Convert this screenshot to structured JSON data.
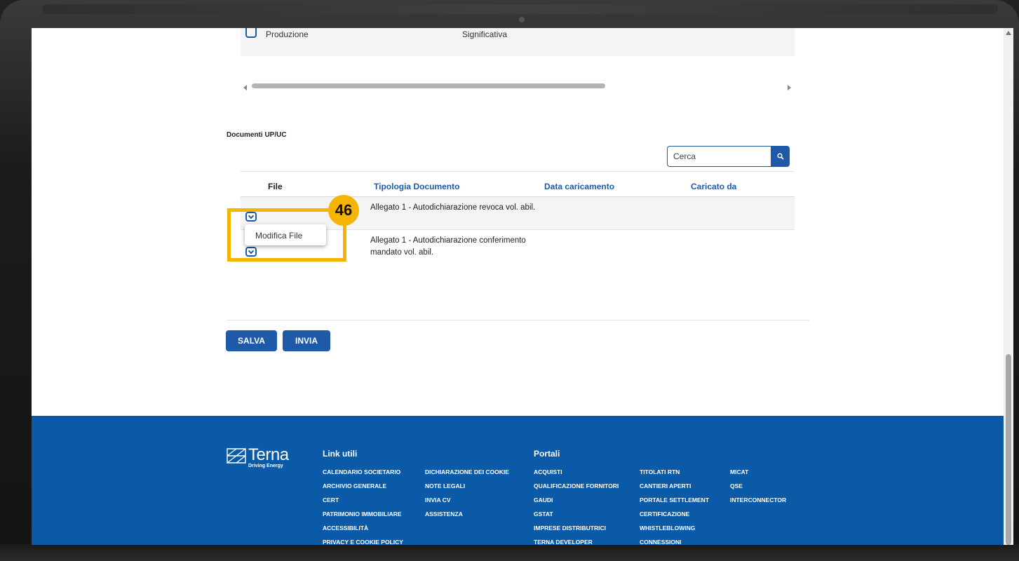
{
  "top_row": {
    "label": "Produzione",
    "value": "Significativa"
  },
  "section": {
    "title": "Documenti UP/UC"
  },
  "search": {
    "placeholder": "Cerca"
  },
  "table": {
    "headers": {
      "file": "File",
      "tipologia": "Tipologia Documento",
      "data": "Data caricamento",
      "caricato": "Caricato da"
    },
    "rows": [
      {
        "tipologia": "Allegato 1 - Autodichiarazione revoca vol. abil.",
        "data": "",
        "caricato": ""
      },
      {
        "tipologia": "Allegato 1 - Autodichiarazione conferimento mandato vol. abil.",
        "data": "",
        "caricato": ""
      }
    ]
  },
  "dropdown": {
    "item": "Modifica File"
  },
  "annotation": {
    "step": "46",
    "color": "#f5b400"
  },
  "actions": {
    "save": "SALVA",
    "send": "INVIA"
  },
  "colors": {
    "primary": "#1f5aa8",
    "footer": "#0a5aa8"
  },
  "footer": {
    "logo": {
      "name": "Terna",
      "tagline": "Driving Energy"
    },
    "link_utili": {
      "title": "Link utili",
      "col1": [
        "CALENDARIO SOCIETARIO",
        "ARCHIVIO GENERALE",
        "CERT",
        "PATRIMONIO IMMOBILIARE",
        "ACCESSIBILITÀ",
        "PRIVACY E COOKIE POLICY"
      ],
      "col2": [
        "DICHIARAZIONE DEI COOKIE",
        "NOTE LEGALI",
        "INVIA CV",
        "ASSISTENZA"
      ]
    },
    "portali": {
      "title": "Portali",
      "col1": [
        "ACQUISTI",
        "QUALIFICAZIONE FORNITORI",
        "GAUDI",
        "GSTAT",
        "IMPRESE DISTRIBUTRICI",
        "TERNA DEVELOPER"
      ],
      "col2": [
        "TITOLATI RTN",
        "CANTIERI APERTI",
        "PORTALE SETTLEMENT",
        "CERTIFICAZIONE",
        "WHISTLEBLOWING",
        "CONNESSIONI"
      ],
      "col3": [
        "MICAT",
        "QSE",
        "INTERCONNECTOR"
      ]
    }
  }
}
